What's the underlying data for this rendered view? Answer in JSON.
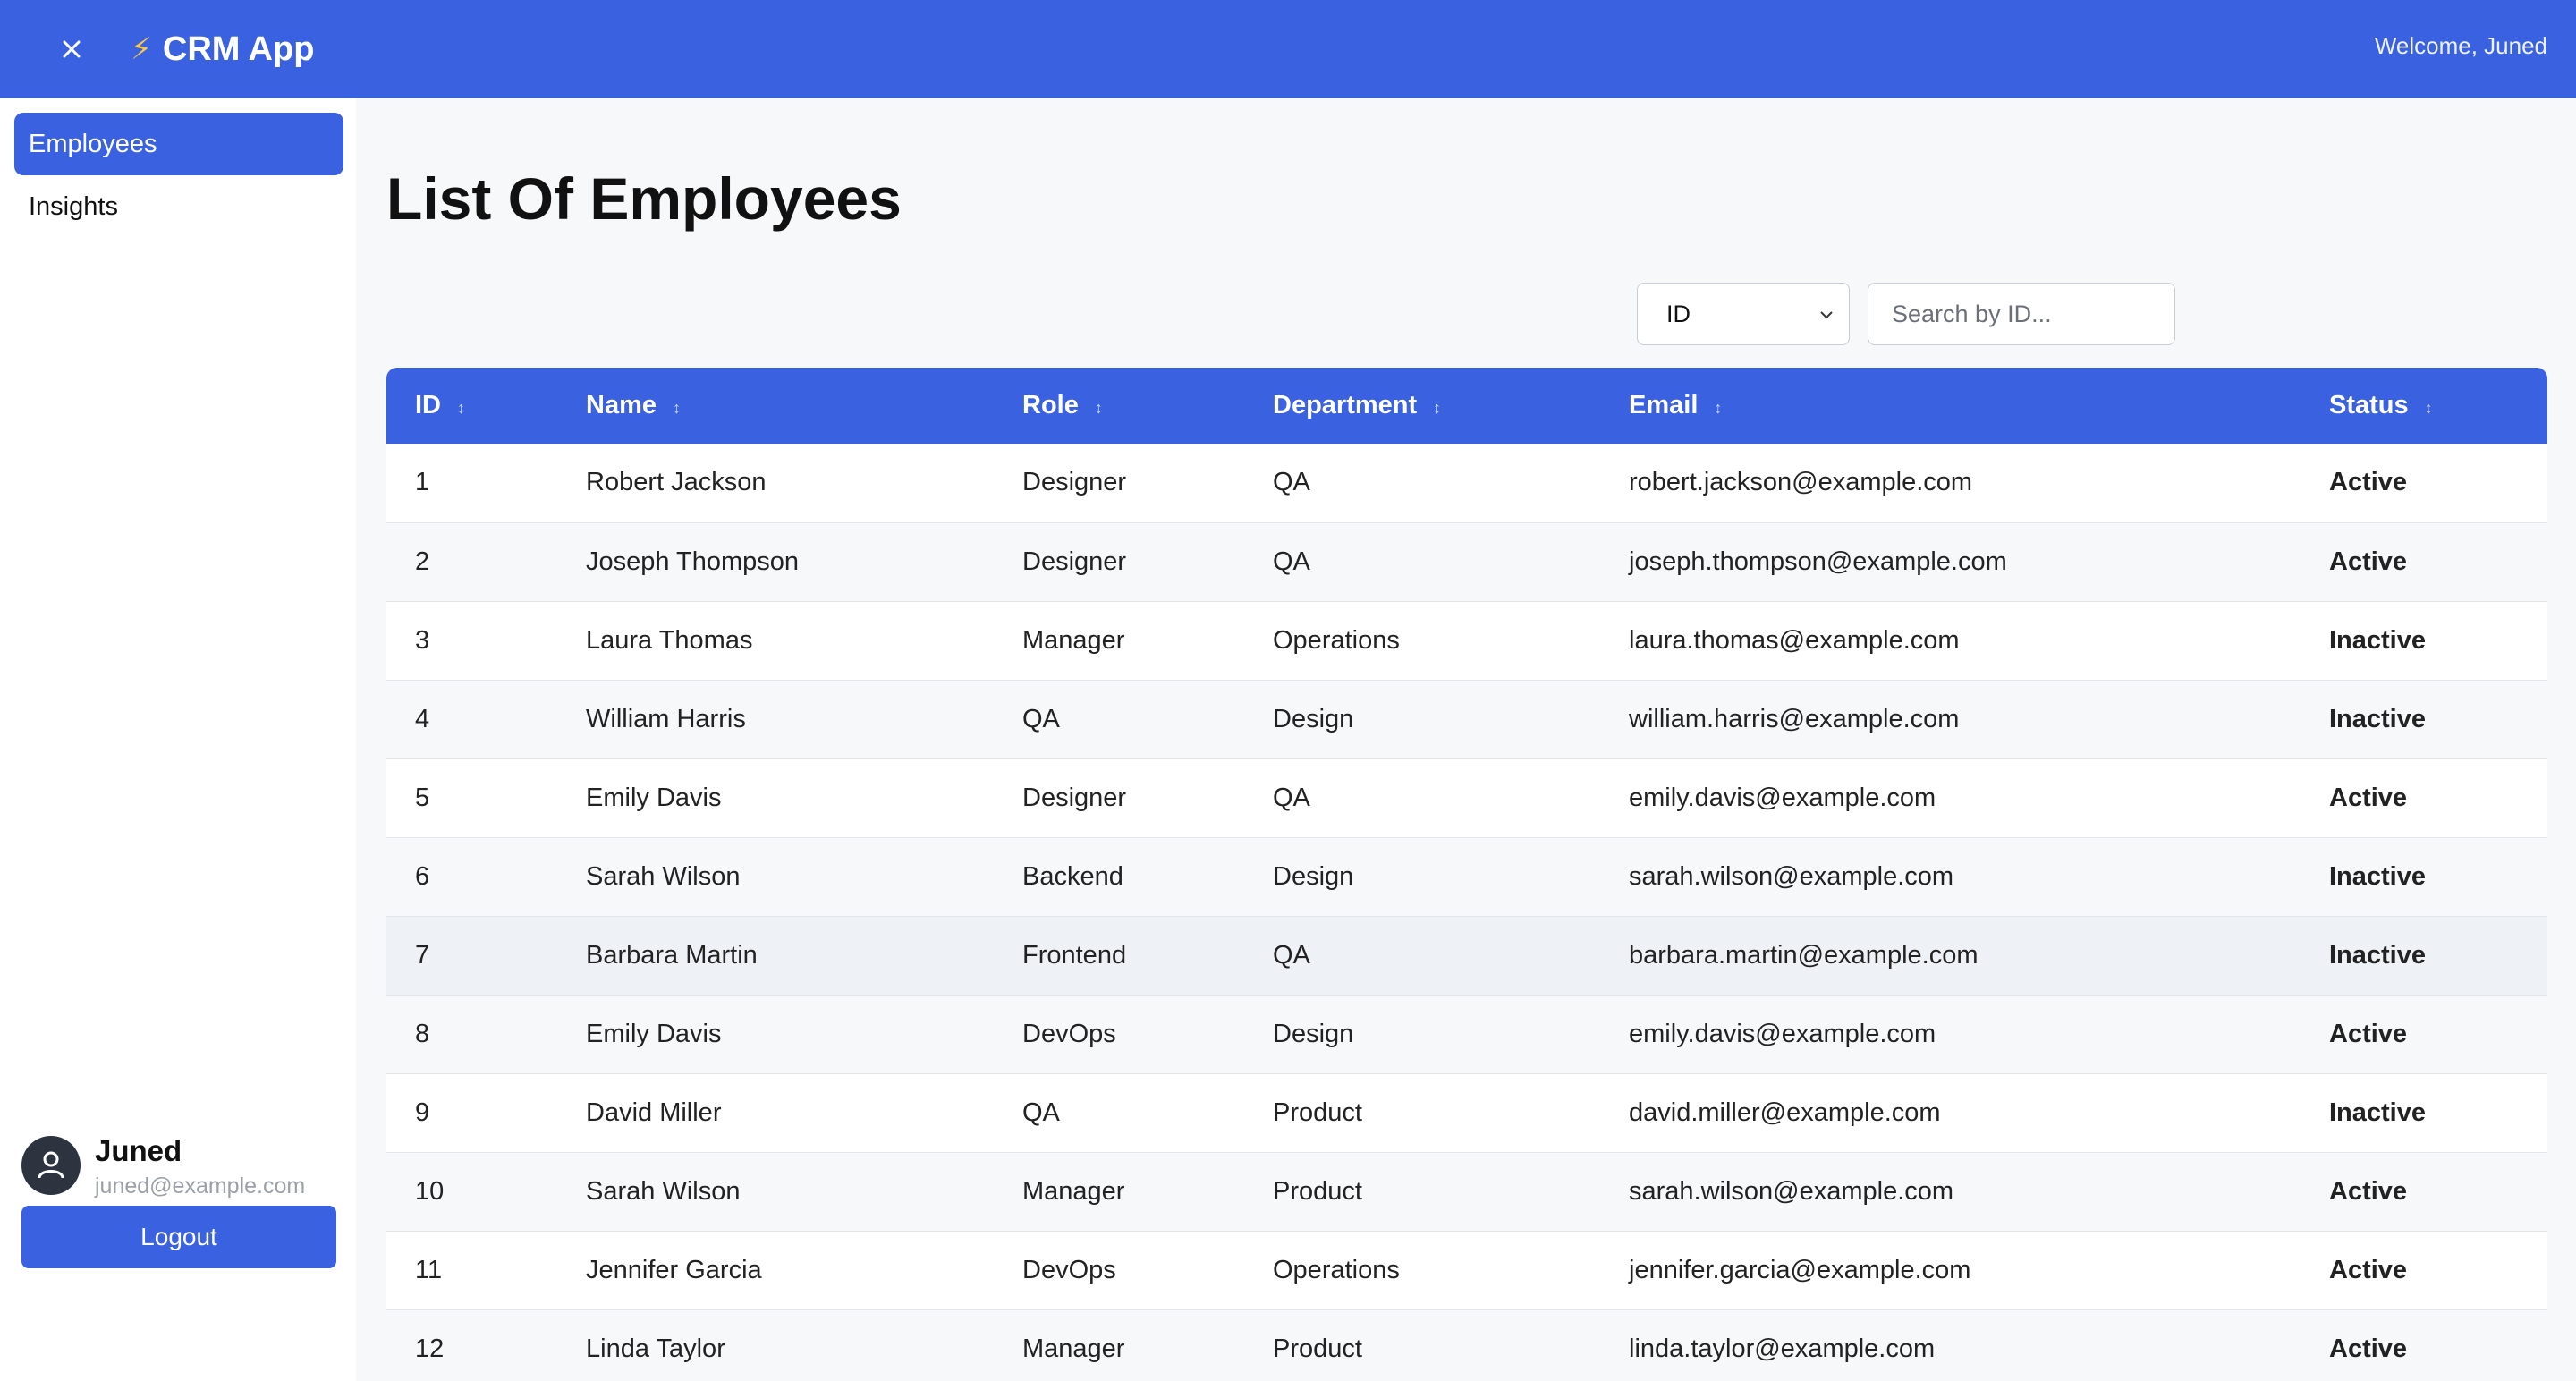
{
  "topbar": {
    "app_name": "CRM App",
    "welcome_text": "Welcome, Juned"
  },
  "sidebar": {
    "items": [
      {
        "label": "Employees",
        "active": true
      },
      {
        "label": "Insights",
        "active": false
      }
    ],
    "user": {
      "name": "Juned",
      "email": "juned@example.com"
    },
    "logout_label": "Logout"
  },
  "main": {
    "title": "List Of Employees",
    "filter": {
      "selected": "ID",
      "search_placeholder": "Search by ID..."
    },
    "table": {
      "columns": [
        "ID",
        "Name",
        "Role",
        "Department",
        "Email",
        "Status"
      ],
      "rows": [
        {
          "id": "1",
          "name": "Robert Jackson",
          "role": "Designer",
          "department": "QA",
          "email": "robert.jackson@example.com",
          "status": "Active"
        },
        {
          "id": "2",
          "name": "Joseph Thompson",
          "role": "Designer",
          "department": "QA",
          "email": "joseph.thompson@example.com",
          "status": "Active"
        },
        {
          "id": "3",
          "name": "Laura Thomas",
          "role": "Manager",
          "department": "Operations",
          "email": "laura.thomas@example.com",
          "status": "Inactive"
        },
        {
          "id": "4",
          "name": "William Harris",
          "role": "QA",
          "department": "Design",
          "email": "william.harris@example.com",
          "status": "Inactive"
        },
        {
          "id": "5",
          "name": "Emily Davis",
          "role": "Designer",
          "department": "QA",
          "email": "emily.davis@example.com",
          "status": "Active"
        },
        {
          "id": "6",
          "name": "Sarah Wilson",
          "role": "Backend",
          "department": "Design",
          "email": "sarah.wilson@example.com",
          "status": "Inactive"
        },
        {
          "id": "7",
          "name": "Barbara Martin",
          "role": "Frontend",
          "department": "QA",
          "email": "barbara.martin@example.com",
          "status": "Inactive"
        },
        {
          "id": "8",
          "name": "Emily Davis",
          "role": "DevOps",
          "department": "Design",
          "email": "emily.davis@example.com",
          "status": "Active"
        },
        {
          "id": "9",
          "name": "David Miller",
          "role": "QA",
          "department": "Product",
          "email": "david.miller@example.com",
          "status": "Inactive"
        },
        {
          "id": "10",
          "name": "Sarah Wilson",
          "role": "Manager",
          "department": "Product",
          "email": "sarah.wilson@example.com",
          "status": "Active"
        },
        {
          "id": "11",
          "name": "Jennifer Garcia",
          "role": "DevOps",
          "department": "Operations",
          "email": "jennifer.garcia@example.com",
          "status": "Active"
        },
        {
          "id": "12",
          "name": "Linda Taylor",
          "role": "Manager",
          "department": "Product",
          "email": "linda.taylor@example.com",
          "status": "Active"
        }
      ]
    }
  },
  "icons": {
    "close": "close-icon",
    "brand": "lightning-icon",
    "sort": "sort-icon",
    "select_arrow": "chevron-down-icon",
    "avatar": "user-icon"
  },
  "colors": {
    "primary": "#3a62e0",
    "accent_bolt": "#f7c948",
    "page_bg": "#f7f8fa"
  }
}
